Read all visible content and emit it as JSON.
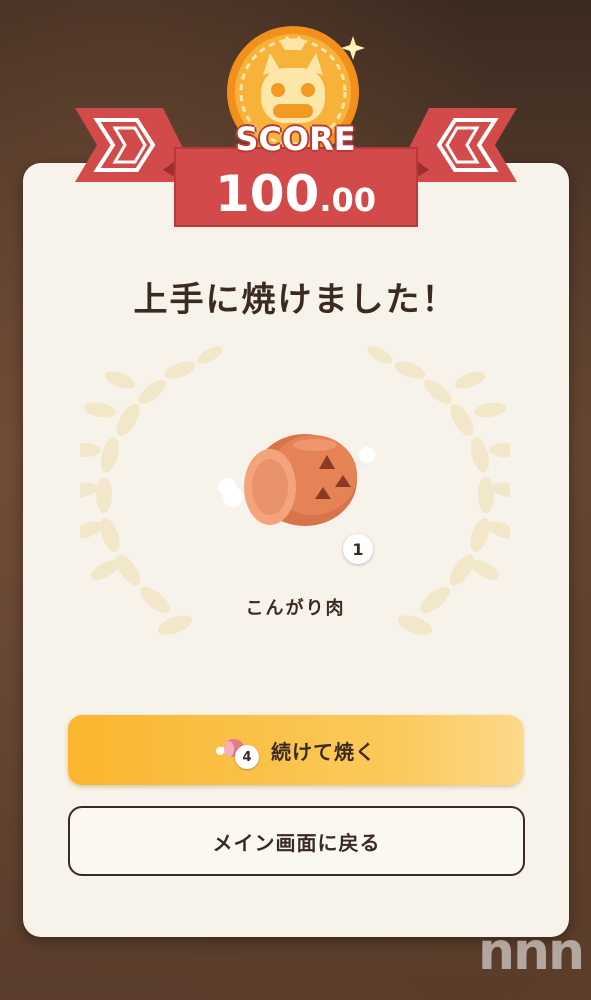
{
  "result": {
    "score_label": "SCORE",
    "score_integer": "100",
    "score_decimal": ".00",
    "message": "上手に焼けました！"
  },
  "reward": {
    "item_name": "こんがり肉",
    "quantity": "1",
    "icon": "roasted-meat-icon"
  },
  "actions": {
    "continue_label": "続けて焼く",
    "continue_remaining": "4",
    "back_label": "メイン画面に戻る"
  },
  "watermark": "nnn",
  "colors": {
    "ribbon": "#d24a4a",
    "card": "#f8f3ea",
    "primary_button": "#fab62e",
    "text": "#3a2a22",
    "coin": "#f7a11a"
  }
}
